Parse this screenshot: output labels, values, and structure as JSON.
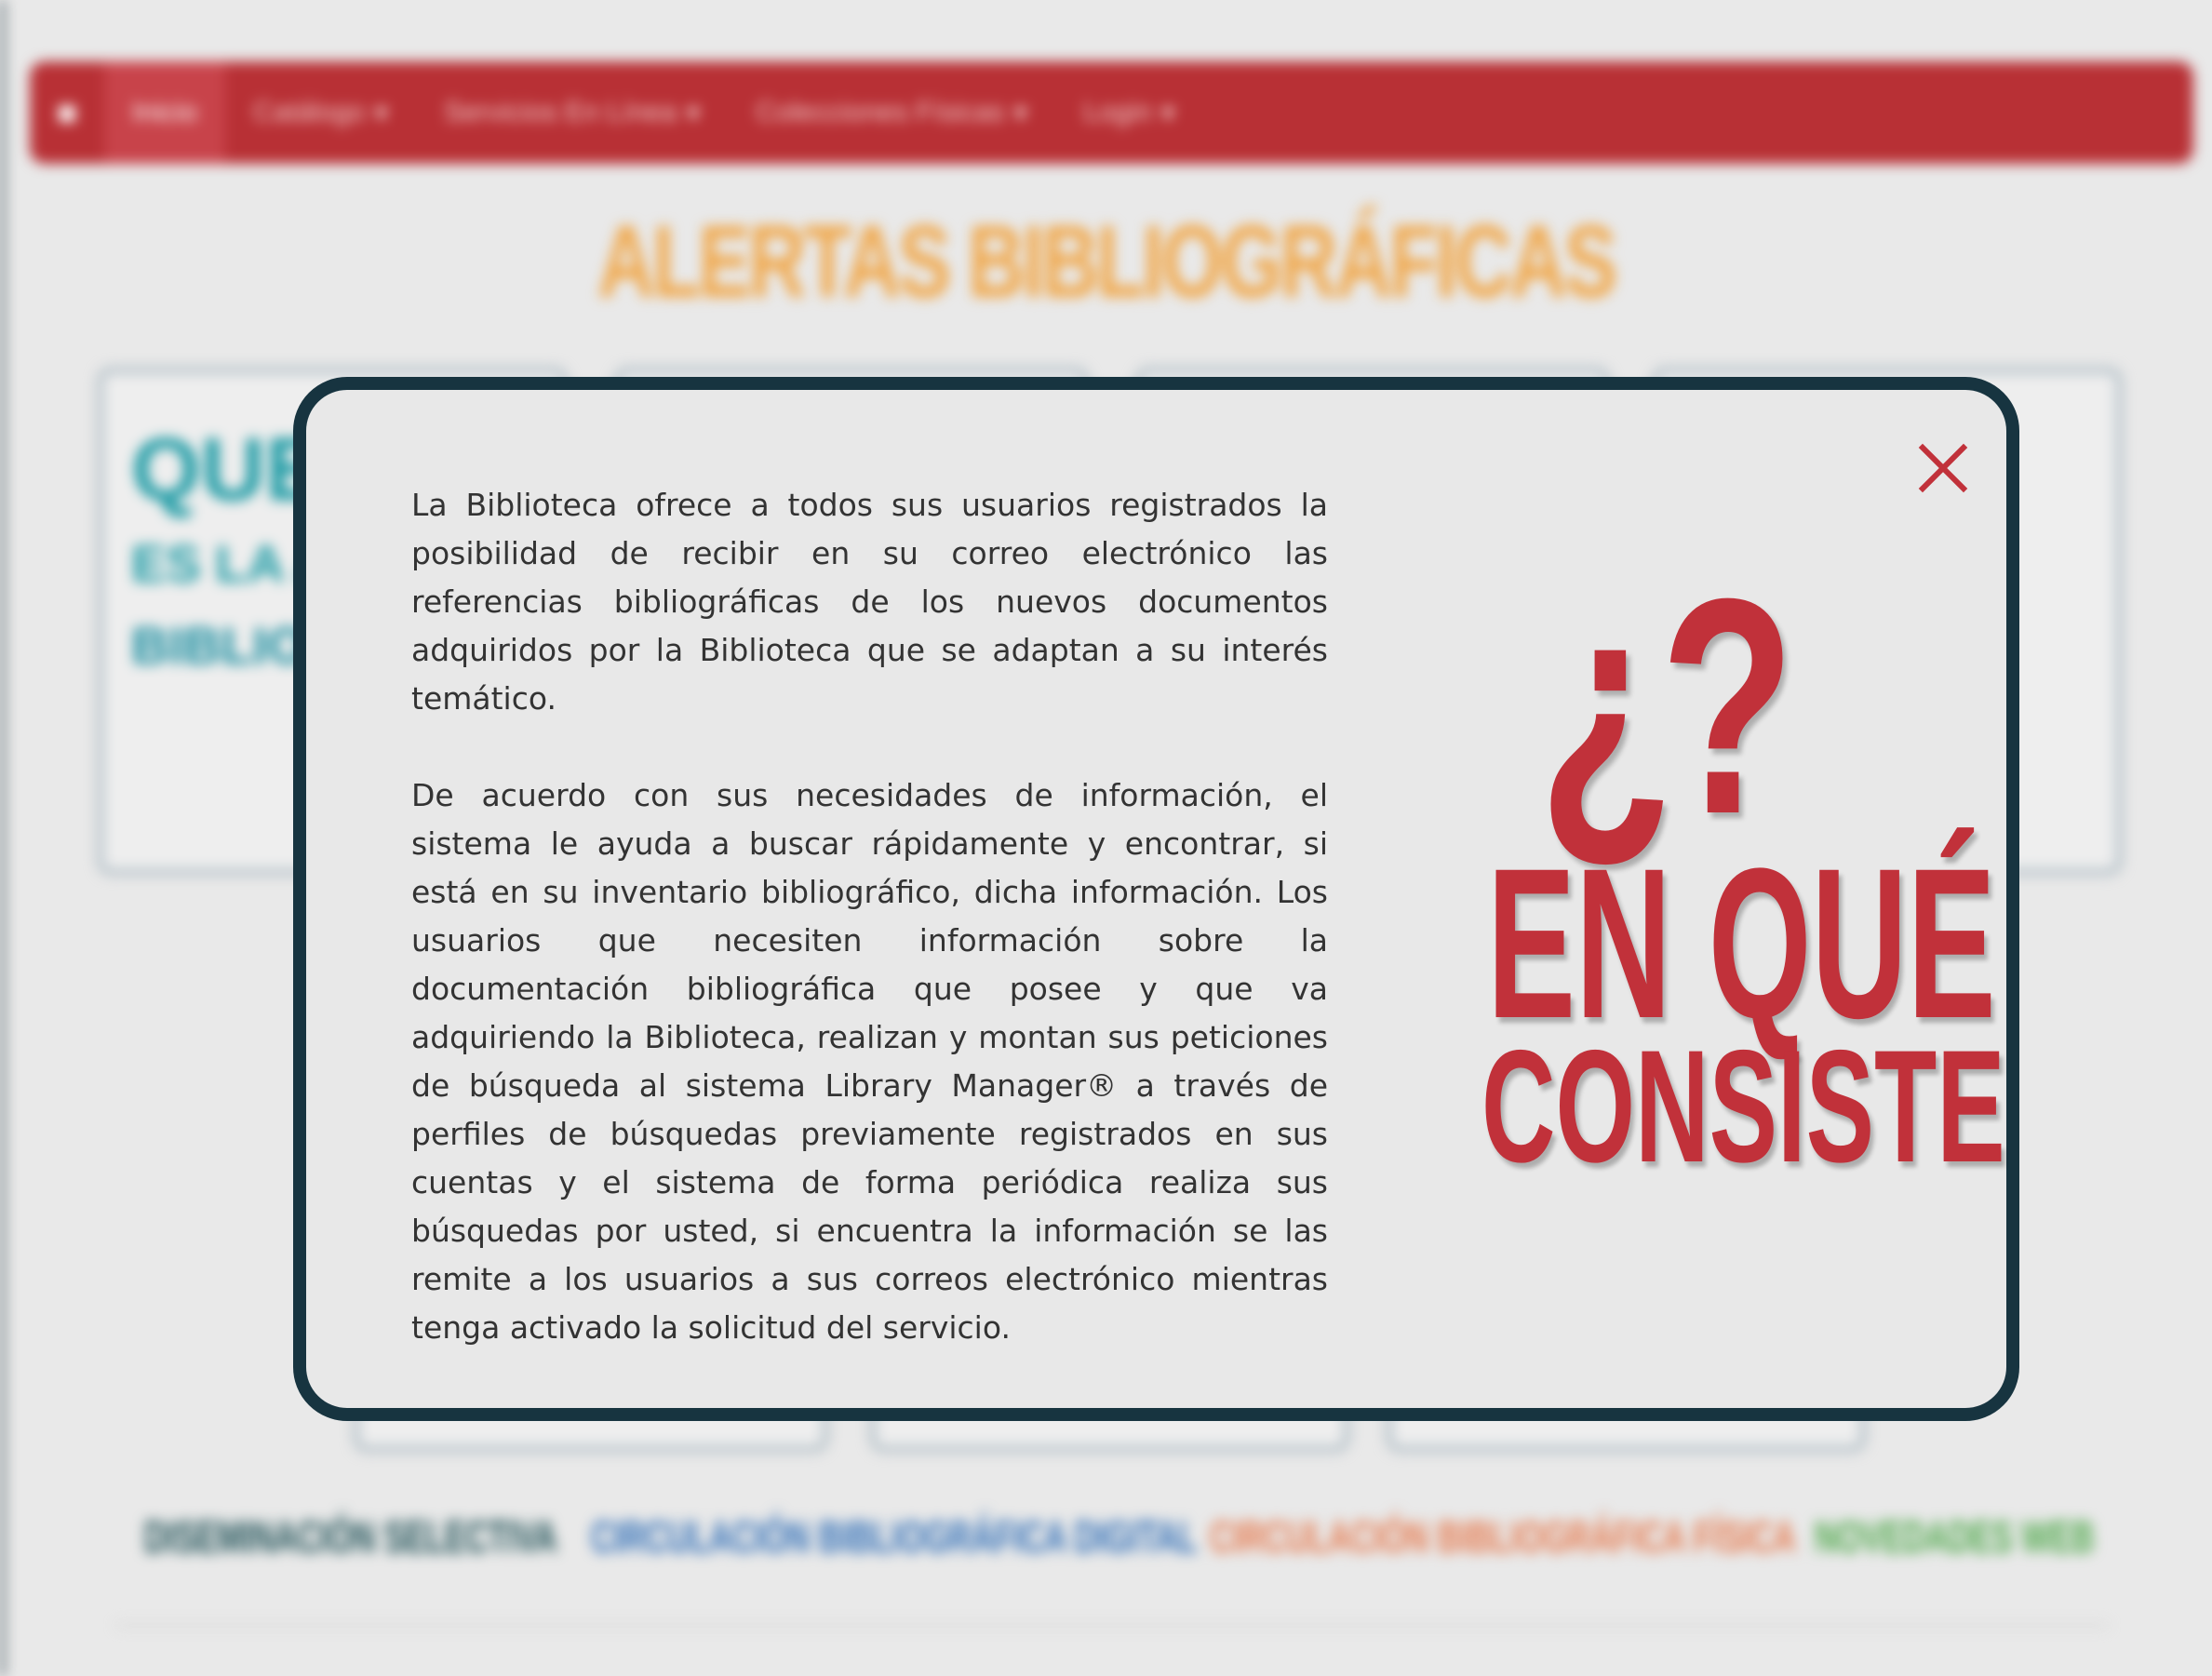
{
  "navbar": {
    "home_icon": "home-icon",
    "items": [
      {
        "label": "Inicio",
        "has_caret": false
      },
      {
        "label": "Catálogo",
        "has_caret": true
      },
      {
        "label": "Servicios En Línea",
        "has_caret": true
      },
      {
        "label": "Colecciones Físicas",
        "has_caret": true
      },
      {
        "label": "Login",
        "has_caret": true
      }
    ],
    "caret_glyph": "▾"
  },
  "page": {
    "title": "ALERTAS BIBLIOGRÁFICAS",
    "card": {
      "title": "QUE",
      "subtitle_1": "ES LA A",
      "subtitle_2": "BIBLIO"
    },
    "footer_links": [
      {
        "label": "DISEMINACIÓN SELECTIVA",
        "color": "#1d4f55"
      },
      {
        "label": "CIRCULACIÓN BIBLIOGRÁFICA DIGITAL",
        "color": "#2f6eb7"
      },
      {
        "label": "CIRCULACIÓN BIBLIOGRÁFICA FÍSICA",
        "color": "#e5794d"
      },
      {
        "label": "NOVEDADES WEB",
        "color": "#4fa84b"
      }
    ]
  },
  "modal": {
    "close_icon": "close-icon",
    "paragraphs": [
      "La Biblioteca ofrece a todos sus usuarios registrados la posibilidad de recibir en su correo electrónico las referencias bibliográficas de los nuevos documentos adquiridos por la Biblioteca que se adaptan a su interés temático.",
      "De acuerdo con sus necesidades de información, el sistema le ayuda a buscar rápidamente y encontrar, si está en su inventario bibliográfico,  dicha información. Los usuarios que necesiten información sobre la documentación bibliográfica que posee y que va adquiriendo la Biblioteca, realizan y montan sus peticiones de búsqueda al sistema Library Manager® a través de perfiles de búsquedas previamente registrados en sus cuentas y el sistema de forma periódica realiza sus búsquedas por usted, si encuentra la información se las remite a los usuarios a sus correos electrónico mientras tenga activado la solicitud del servicio."
    ],
    "hero": {
      "question_marks": "¿?",
      "line1": "EN QUÉ",
      "line2": "CONSISTE"
    }
  },
  "colors": {
    "navbar": "#b83035",
    "title": "#f0a84c",
    "modal_border": "#173440",
    "accent_red": "#c1313a"
  }
}
